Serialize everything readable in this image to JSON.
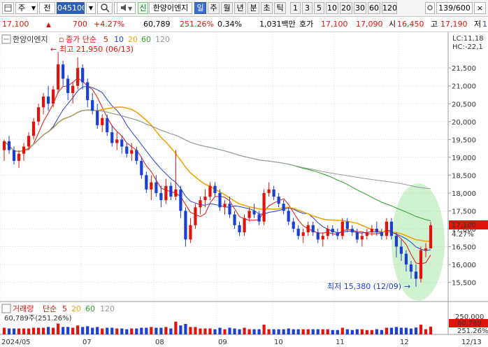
{
  "toolbar": {
    "icon_left": "window-icon",
    "market": "주",
    "market_option": "전",
    "code": "045100",
    "search_icon": "search-icon",
    "grid_icon": "grid-icon",
    "sound_icon": "speaker-icon",
    "shin": "신",
    "stock_name": "한양이엔지",
    "period_tabs": [
      "일",
      "주",
      "월",
      "년",
      "분",
      "초",
      "틱"
    ],
    "period_active": 0,
    "interval_tabs": [
      "1",
      "3",
      "5",
      "10",
      "20",
      "30",
      "60",
      "120"
    ],
    "counter": "139/600",
    "close": "×"
  },
  "infobar": {
    "price": "17,100",
    "change": "700",
    "change_pct": "+4.27%",
    "volume": "60,789",
    "volume_ratio": "251.26%",
    "turnover": "0.34%",
    "amount": "1,031백만",
    "quote_label": "호가",
    "ask": "17,100",
    "bid": "17,090",
    "open_label": "시",
    "open": "16,450",
    "high_label": "고",
    "high": "17,190",
    "low_label": "저",
    "low": "1"
  },
  "legend": {
    "name": "한양이엔지",
    "ma_label": "종가 단순",
    "ma_periods": [
      "5",
      "10",
      "20",
      "60",
      "120"
    ],
    "ma_colors": [
      "#e0140c",
      "#2340d6",
      "#f2a500",
      "#2aa02a",
      "#999999"
    ],
    "lc": "LC:11,18",
    "hc": "HC:-22,1"
  },
  "volume_legend": {
    "label": "거래량",
    "ma_label": "단순",
    "ma_periods": [
      "5",
      "20",
      "60",
      "120"
    ],
    "value": "60,789주(251.26%)"
  },
  "annotations": {
    "high": "최고 21,950 (06/13)",
    "low": "최저 15,380 (12/09)"
  },
  "current_price_label": "17,100",
  "current_pct_label": "4.27%",
  "volume_axis": {
    "top": "250,000",
    "current": "60,789",
    "pct": "251.26%"
  },
  "chart_data": {
    "type": "candlestick",
    "y_ticks": [
      21500,
      21000,
      20500,
      20000,
      19500,
      19000,
      18500,
      18000,
      17500,
      17000,
      16500,
      16000,
      15500
    ],
    "ylim": [
      15100,
      22150
    ],
    "x_labels": [
      "2024/05",
      "07",
      "08",
      "09",
      "10",
      "11",
      "12",
      "12/13"
    ],
    "grid": true,
    "series_ma": [
      "5",
      "10",
      "20",
      "60",
      "120"
    ],
    "candles": [
      [
        19200,
        19500,
        18900,
        19450
      ],
      [
        19450,
        19600,
        19100,
        19200
      ],
      [
        19200,
        19300,
        18800,
        18900
      ],
      [
        18900,
        19200,
        18700,
        19100
      ],
      [
        19100,
        19400,
        18900,
        19300
      ],
      [
        19300,
        19700,
        19200,
        19600
      ],
      [
        19600,
        20100,
        19500,
        20000
      ],
      [
        20000,
        20500,
        19900,
        20400
      ],
      [
        20400,
        20800,
        20200,
        20700
      ],
      [
        20700,
        21000,
        20300,
        20500
      ],
      [
        20500,
        21000,
        20400,
        20900
      ],
      [
        20900,
        21950,
        20800,
        21600
      ],
      [
        21600,
        21700,
        21000,
        21200
      ],
      [
        21200,
        21300,
        20600,
        20800
      ],
      [
        20800,
        21100,
        20500,
        21000
      ],
      [
        21000,
        21800,
        20900,
        21500
      ],
      [
        21500,
        21600,
        20900,
        21100
      ],
      [
        21100,
        21200,
        20400,
        20600
      ],
      [
        20600,
        20800,
        20200,
        20300
      ],
      [
        20300,
        20500,
        19800,
        19900
      ],
      [
        19900,
        20200,
        19700,
        20100
      ],
      [
        20100,
        20200,
        19600,
        19700
      ],
      [
        19700,
        19900,
        19300,
        19400
      ],
      [
        19400,
        19700,
        19200,
        19500
      ],
      [
        19500,
        19600,
        19100,
        19300
      ],
      [
        19300,
        19400,
        19000,
        19100
      ],
      [
        19100,
        19400,
        18900,
        19200
      ],
      [
        19200,
        19300,
        18800,
        18900
      ],
      [
        18900,
        19000,
        18400,
        18500
      ],
      [
        18500,
        18600,
        18000,
        18100
      ],
      [
        18100,
        18500,
        17800,
        18300
      ],
      [
        18300,
        18500,
        17900,
        18000
      ],
      [
        18000,
        18200,
        17600,
        17800
      ],
      [
        17800,
        18400,
        17700,
        18200
      ],
      [
        18200,
        18300,
        17800,
        17900
      ],
      [
        17900,
        19200,
        17800,
        18100
      ],
      [
        18100,
        18200,
        17300,
        17500
      ],
      [
        17500,
        17600,
        16500,
        16700
      ],
      [
        16700,
        17300,
        16600,
        17100
      ],
      [
        17100,
        17700,
        17000,
        17600
      ],
      [
        17600,
        17900,
        17400,
        17800
      ],
      [
        17800,
        18100,
        17600,
        17900
      ],
      [
        17900,
        18300,
        17800,
        18200
      ],
      [
        18200,
        18300,
        17900,
        18000
      ],
      [
        18000,
        18100,
        17500,
        17600
      ],
      [
        17600,
        17800,
        17400,
        17700
      ],
      [
        17700,
        17900,
        17300,
        17400
      ],
      [
        17400,
        17500,
        17000,
        17100
      ],
      [
        17100,
        17200,
        16800,
        16900
      ],
      [
        16900,
        17400,
        16800,
        17300
      ],
      [
        17300,
        17600,
        17200,
        17500
      ],
      [
        17500,
        17700,
        17300,
        17400
      ],
      [
        17400,
        17500,
        17100,
        17200
      ],
      [
        17200,
        18100,
        17100,
        18000
      ],
      [
        18000,
        18300,
        17900,
        18100
      ],
      [
        18100,
        18200,
        17800,
        17900
      ],
      [
        17900,
        18000,
        17600,
        17700
      ],
      [
        17700,
        17800,
        17400,
        17500
      ],
      [
        17500,
        17600,
        17100,
        17200
      ],
      [
        17200,
        17300,
        16900,
        17000
      ],
      [
        17000,
        17100,
        16700,
        16800
      ],
      [
        16800,
        17000,
        16600,
        16900
      ],
      [
        16900,
        17200,
        16800,
        17100
      ],
      [
        17100,
        17200,
        16800,
        16900
      ],
      [
        16900,
        17000,
        16600,
        16700
      ],
      [
        16700,
        16900,
        16500,
        16800
      ],
      [
        16800,
        17100,
        16700,
        17000
      ],
      [
        17000,
        17100,
        16800,
        16900
      ],
      [
        16900,
        17000,
        16700,
        16800
      ],
      [
        16800,
        17300,
        16700,
        17200
      ],
      [
        17200,
        17300,
        16900,
        17000
      ],
      [
        17000,
        17100,
        16800,
        16900
      ],
      [
        16900,
        17000,
        16600,
        16700
      ],
      [
        16700,
        16900,
        16500,
        16800
      ],
      [
        16800,
        17000,
        16700,
        16900
      ],
      [
        16900,
        17100,
        16800,
        17000
      ],
      [
        17000,
        17200,
        16800,
        16900
      ],
      [
        16900,
        17000,
        16700,
        16800
      ],
      [
        16800,
        17300,
        16700,
        17200
      ],
      [
        17200,
        17300,
        16700,
        16800
      ],
      [
        16800,
        16900,
        16200,
        16500
      ],
      [
        16500,
        16700,
        16100,
        16300
      ],
      [
        16300,
        16400,
        15800,
        16000
      ],
      [
        16000,
        16100,
        15600,
        15800
      ],
      [
        15800,
        16000,
        15380,
        15600
      ],
      [
        15600,
        16500,
        15500,
        16400
      ],
      [
        16400,
        16600,
        16200,
        16450
      ],
      [
        16450,
        17190,
        16450,
        17100
      ]
    ],
    "volume_ylim": [
      0,
      250000
    ]
  }
}
